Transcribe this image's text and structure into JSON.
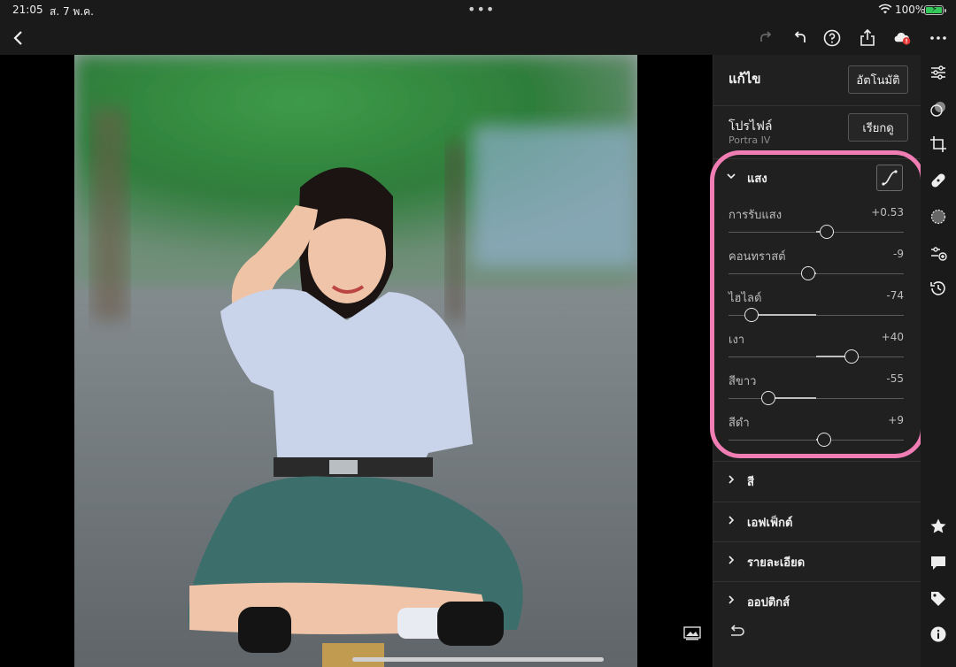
{
  "statusbar": {
    "time": "21:05",
    "date": "ส. 7 พ.ค.",
    "battery_text": "100%",
    "battery_level": 1.0,
    "icons": [
      "wifi-icon",
      "battery-icon",
      "multitasking-dots-icon"
    ]
  },
  "toolbar": {
    "icons": [
      "back-chevron-icon",
      "redo-icon",
      "undo-icon",
      "help-icon",
      "share-icon",
      "cloud-sync-error-icon",
      "more-icon"
    ]
  },
  "panel": {
    "title": "แก้ไข",
    "auto_label": "อัตโนมัติ",
    "profile_label": "โปรไฟล์",
    "profile_value": "Portra IV",
    "browse_label": "เรียกดู",
    "light_section": {
      "label": "แสง",
      "expanded": true,
      "sliders": [
        {
          "label": "การรับแสง",
          "value": "+0.53",
          "position": 0.56
        },
        {
          "label": "คอนทราสต์",
          "value": "-9",
          "position": 0.455
        },
        {
          "label": "ไฮไลต์",
          "value": "-74",
          "position": 0.13
        },
        {
          "label": "เงา",
          "value": "+40",
          "position": 0.7
        },
        {
          "label": "สีขาว",
          "value": "-55",
          "position": 0.225
        },
        {
          "label": "สีดำ",
          "value": "+9",
          "position": 0.545
        }
      ]
    },
    "collapsed_sections": [
      {
        "label": "สี"
      },
      {
        "label": "เอฟเฟ็กต์"
      },
      {
        "label": "รายละเอียด"
      },
      {
        "label": "ออปติกส์"
      }
    ],
    "highlight_color": "#f07eb4"
  },
  "rail": {
    "icons": [
      "edit-sliders-icon",
      "masking-icon",
      "crop-icon",
      "healing-icon",
      "selective-icon",
      "presets-icon",
      "versions-icon",
      "rating-star-icon",
      "comment-icon",
      "keyword-tag-icon",
      "info-icon"
    ]
  }
}
